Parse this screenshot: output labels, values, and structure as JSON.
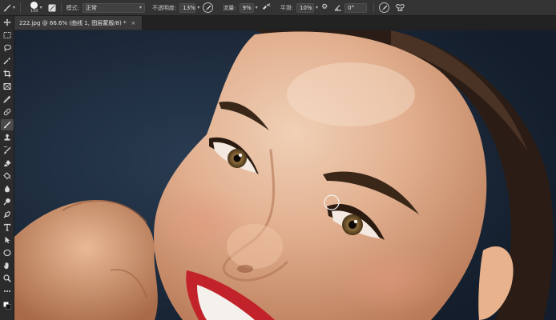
{
  "app": {
    "options_bar": {
      "brush_size": "100",
      "mode_label": "模式:",
      "mode_value": "正常",
      "opacity_label": "不透明度:",
      "opacity_value": "13%",
      "flow_label": "流量:",
      "flow_value": "9%",
      "smoothing_label": "平滑:",
      "smoothing_value": "10%",
      "angle_value": "0°"
    },
    "document_tab": {
      "title": "222.jpg @ 66.6% (曲线 1, 图层蒙版/8) *",
      "close_glyph": "×"
    },
    "toolbar": {
      "tools": [
        "move-tool",
        "marquee-tool",
        "lasso-tool",
        "magic-wand-tool",
        "crop-tool",
        "frame-tool",
        "eyedropper-tool",
        "healing-brush-tool",
        "brush-tool",
        "clone-stamp-tool",
        "history-brush-tool",
        "eraser-tool",
        "paint-bucket-tool",
        "blur-tool",
        "dodge-tool",
        "pen-tool",
        "type-tool",
        "path-selection-tool",
        "rectangle-tool",
        "hand-tool",
        "zoom-tool",
        "more-tools"
      ],
      "active_tool": "brush-tool"
    },
    "colors": {
      "accent": "#e6e6e6",
      "panel": "#333333",
      "canvas_background": "#1d2d40"
    }
  }
}
